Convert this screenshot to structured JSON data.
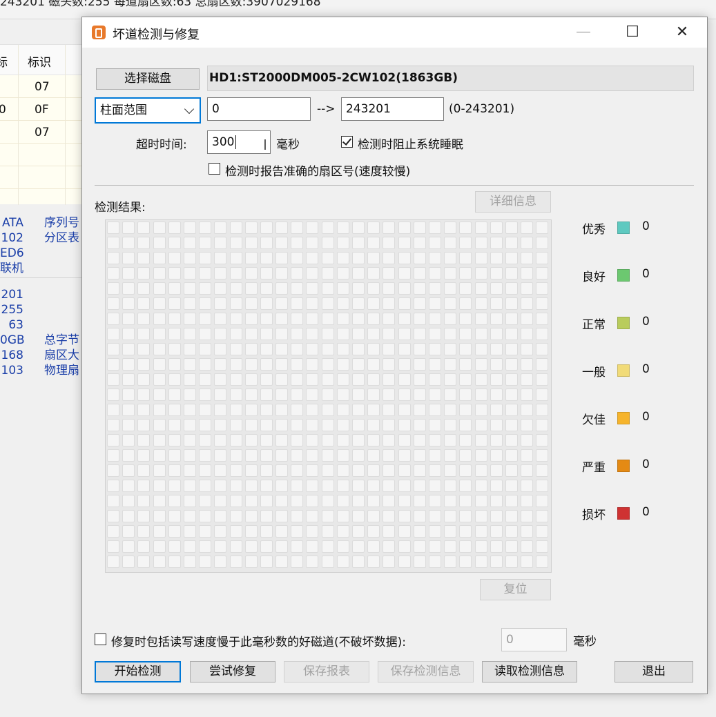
{
  "background": {
    "top_info": "243201  磁头数:255  每道扇区数:63  总扇区数:3907029168",
    "table_headers": [
      "标",
      "标识"
    ],
    "table_rows": [
      {
        "a": "",
        "b": "07"
      },
      {
        "a": "0",
        "b": "0F"
      },
      {
        "a": "",
        "b": "07"
      }
    ],
    "info_left_1": [
      "ATA",
      "102",
      "ED6",
      "联机"
    ],
    "info_right_1": [
      "序列号",
      "分区表"
    ],
    "info_left_2": [
      "201",
      "255",
      "63",
      "0GB",
      "168",
      "103"
    ],
    "info_right_2": [
      "总字节",
      "扇区大",
      "物理扇"
    ]
  },
  "dialog": {
    "title": "坏道检测与修复",
    "window_controls": {
      "minimize": "—",
      "maximize": "☐",
      "close": "✕"
    },
    "select_disk_label": "选择磁盘",
    "disk_name": "HD1:ST2000DM005-2CW102(1863GB)",
    "range_mode": "柱面范围",
    "range_start": "0",
    "range_arrow": "-->",
    "range_end": "243201",
    "range_hint": "(0-243201)",
    "timeout_label": "超时时间:",
    "timeout_value": "300",
    "timeout_unit": "毫秒",
    "prevent_sleep_label": "检测时阻止系统睡眠",
    "prevent_sleep_checked": true,
    "report_sector_label": "检测时报告准确的扇区号(速度较慢)",
    "report_sector_checked": false,
    "results_label": "检测结果:",
    "details_button": "详细信息",
    "reset_button": "复位",
    "legend": [
      {
        "label": "优秀",
        "color": "#5ec9c0",
        "count": "0"
      },
      {
        "label": "良好",
        "color": "#6cc870",
        "count": "0"
      },
      {
        "label": "正常",
        "color": "#b9cc5c",
        "count": "0"
      },
      {
        "label": "一般",
        "color": "#f1db78",
        "count": "0"
      },
      {
        "label": "欠佳",
        "color": "#f6b42c",
        "count": "0"
      },
      {
        "label": "严重",
        "color": "#e48a14",
        "count": "0"
      },
      {
        "label": "损坏",
        "color": "#cf3232",
        "count": "0"
      }
    ],
    "repair_slow_label": "修复时包括读写速度慢于此毫秒数的好磁道(不破坏数据):",
    "repair_slow_checked": false,
    "repair_slow_value": "0",
    "repair_slow_unit": "毫秒",
    "buttons": {
      "start": "开始检测",
      "try_repair": "尝试修复",
      "save_report": "保存报表",
      "save_info": "保存检测信息",
      "load_info": "读取检测信息",
      "exit": "退出"
    }
  }
}
